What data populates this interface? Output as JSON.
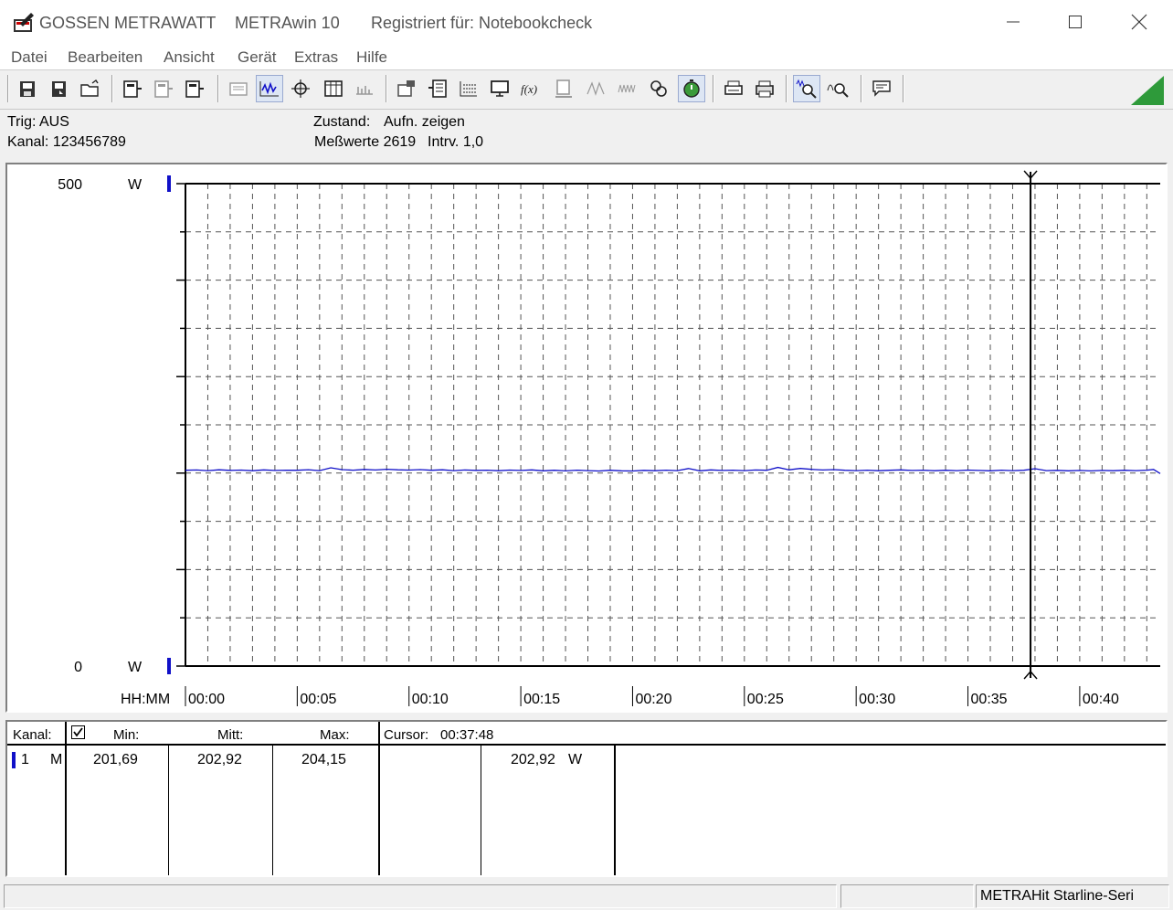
{
  "window": {
    "brand": "GOSSEN METRAWATT",
    "app_name": "METRAwin 10",
    "registration": "Registriert für: Notebookcheck"
  },
  "menu": [
    "Datei",
    "Bearbeiten",
    "Ansicht",
    "Gerät",
    "Extras",
    "Hilfe"
  ],
  "toolbar": {
    "icons": [
      "save-icon",
      "save-as-icon",
      "open-folder-icon",
      "device-read-icon",
      "device-read-disabled-icon",
      "device-write-icon",
      "record-disabled-icon",
      "waveform-icon",
      "crosshair-icon",
      "table-view-icon",
      "bar-view-icon",
      "device-settings-icon",
      "measurement-list-icon",
      "channel-config-icon",
      "monitor-icon",
      "formula-icon",
      "memory-icon",
      "trigger-slope-icon",
      "signal-wave-icon",
      "link-icon",
      "stopwatch-icon",
      "print-preview-icon",
      "print-icon",
      "zoom-waveform-icon",
      "zoom-cursor-icon",
      "comment-icon"
    ],
    "accent": "#2e9a3a"
  },
  "status": {
    "trig": "Trig: AUS",
    "kanal": "Kanal: 123456789",
    "zustand_label": "Zustand:",
    "zustand_value": "Aufn. zeigen",
    "messwerte": "Meßwerte 2619",
    "intrv": "Intrv. 1,0"
  },
  "chart_data": {
    "type": "line",
    "y_top_label": "500",
    "y_bottom_label": "0",
    "y_unit": "W",
    "ylim": [
      0,
      500
    ],
    "x_label": "HH:MM",
    "x_ticks": [
      "00:00",
      "00:05",
      "00:10",
      "00:15",
      "00:20",
      "00:25",
      "00:30",
      "00:35",
      "00:40"
    ],
    "xlim_minutes": [
      0,
      43.6
    ],
    "grid": true,
    "cursor_time_minutes": 37.8,
    "series": [
      {
        "color": "#1010c8",
        "x_minutes": [
          0,
          0.5,
          1,
          1.5,
          2,
          2.5,
          3,
          3.5,
          4,
          4.5,
          5,
          5.5,
          6,
          6.5,
          7,
          7.5,
          8,
          8.5,
          9,
          9.5,
          10,
          10.5,
          11,
          11.5,
          12,
          12.5,
          13,
          13.5,
          14,
          14.5,
          15,
          15.5,
          16,
          16.5,
          17,
          17.5,
          18,
          18.5,
          19,
          19.5,
          20,
          20.5,
          21,
          21.5,
          22,
          22.5,
          23,
          23.5,
          24,
          24.5,
          25,
          25.5,
          26,
          26.5,
          27,
          27.5,
          28,
          28.5,
          29,
          29.5,
          30,
          30.5,
          31,
          31.5,
          32,
          32.5,
          33,
          33.5,
          34,
          34.5,
          35,
          35.5,
          36,
          36.5,
          37,
          37.5,
          38,
          38.5,
          39,
          39.5,
          40,
          40.5,
          41,
          41.5,
          42,
          42.5,
          43,
          43.3,
          43.6
        ],
        "values": [
          202.9,
          203.2,
          202.6,
          203.4,
          202.8,
          203.1,
          202.5,
          203.3,
          202.7,
          203.0,
          202.9,
          203.5,
          202.6,
          205.5,
          203.6,
          203.0,
          203.8,
          203.2,
          204.0,
          203.4,
          203.1,
          203.6,
          202.9,
          203.4,
          202.6,
          203.2,
          202.8,
          203.0,
          202.5,
          203.1,
          202.7,
          203.3,
          202.4,
          202.9,
          202.3,
          203.0,
          202.6,
          202.2,
          202.9,
          202.4,
          202.2,
          202.8,
          202.5,
          203.0,
          202.6,
          204.7,
          202.4,
          203.3,
          202.7,
          203.0,
          202.6,
          203.2,
          202.9,
          205.9,
          203.4,
          204.8,
          203.9,
          203.2,
          203.6,
          202.9,
          202.6,
          203.0,
          202.5,
          202.9,
          203.3,
          202.7,
          203.0,
          202.5,
          202.9,
          202.6,
          203.1,
          202.7,
          202.4,
          203.0,
          202.6,
          202.9,
          204.5,
          202.6,
          202.8,
          202.4,
          202.7,
          202.3,
          202.7,
          202.5,
          202.9,
          202.6,
          203.0,
          203.8,
          199.5
        ]
      }
    ]
  },
  "table": {
    "headers": {
      "kanal": "Kanal:",
      "min": "Min:",
      "mitt": "Mitt:",
      "max": "Max:",
      "cursor_label": "Cursor:",
      "cursor_time": "00:37:48"
    },
    "rows": [
      {
        "channel": "1",
        "mode": "M",
        "min": "201,69",
        "mitt": "202,92",
        "max": "204,15",
        "cursor_value": "202,92",
        "unit": "W",
        "color": "#1010c8"
      }
    ]
  },
  "statusbar": {
    "device": "METRAHit Starline-Seri"
  }
}
